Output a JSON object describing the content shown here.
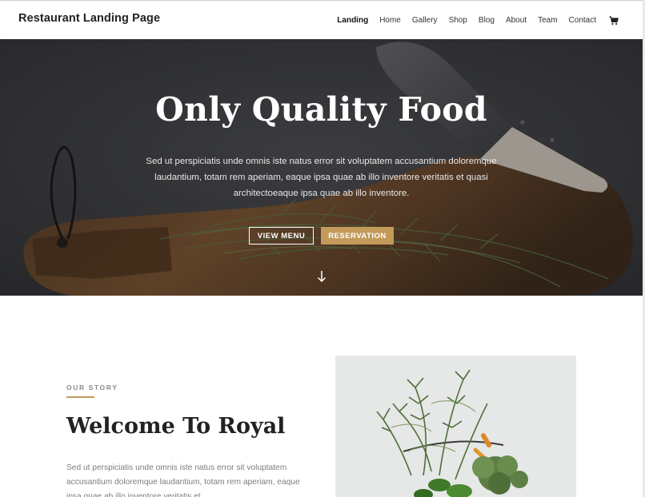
{
  "header": {
    "brand": "Restaurant Landing Page",
    "nav": [
      {
        "label": "Landing",
        "active": true
      },
      {
        "label": "Home"
      },
      {
        "label": "Gallery"
      },
      {
        "label": "Shop"
      },
      {
        "label": "Blog"
      },
      {
        "label": "About"
      },
      {
        "label": "Team"
      },
      {
        "label": "Contact"
      }
    ],
    "cart_icon": "cart-icon"
  },
  "hero": {
    "title": "Only Quality Food",
    "text": "Sed ut perspiciatis unde omnis iste natus error sit voluptatem accusantium doloremque laudantium, totam rem aperiam, eaque ipsa quae ab illo inventore veritatis et quasi architectoeaque ipsa quae ab illo inventore.",
    "buttons": {
      "menu": "VIEW MENU",
      "reservation": "RESERVATION"
    },
    "scroll_icon": "arrow-down-icon"
  },
  "story": {
    "eyebrow": "OUR STORY",
    "title": "Welcome To Royal",
    "text": "Sed ut perspiciatis unde omnis iste natus error sit voluptatem accusantium doloremque laudantium, totam rem aperiam, eaque ipsa quae ab illo inventore veritatis et"
  },
  "colors": {
    "accent": "#c49a5b",
    "hero_bg": "#3c3d3f",
    "text_dark": "#222222",
    "text_muted": "#7d7d7d"
  }
}
